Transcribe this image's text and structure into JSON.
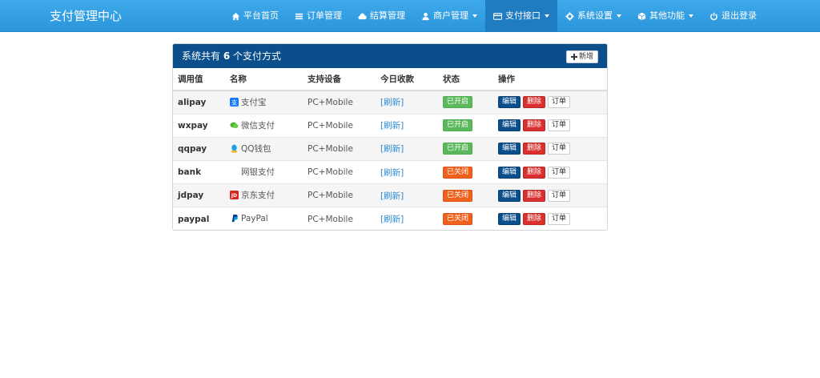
{
  "navbar": {
    "brand": "支付管理中心",
    "items": [
      {
        "label": "平台首页",
        "icon": "home-icon"
      },
      {
        "label": "订单管理",
        "icon": "list-icon"
      },
      {
        "label": "结算管理",
        "icon": "cloud-icon"
      },
      {
        "label": "商户管理",
        "icon": "user-icon",
        "dropdown": true
      },
      {
        "label": "支付接口",
        "icon": "credit-card-icon",
        "dropdown": true,
        "active": true
      },
      {
        "label": "系统设置",
        "icon": "gear-icon",
        "dropdown": true
      },
      {
        "label": "其他功能",
        "icon": "cube-icon",
        "dropdown": true
      },
      {
        "label": "退出登录",
        "icon": "power-icon"
      }
    ]
  },
  "panel": {
    "title_prefix": "系统共有",
    "count": "6",
    "title_suffix": "个支付方式",
    "add_label": "新增"
  },
  "table": {
    "headers": [
      "调用值",
      "名称",
      "支持设备",
      "今日收款",
      "状态",
      "操作"
    ],
    "rows": [
      {
        "code": "alipay",
        "name": "支付宝",
        "icon": "alipay-icon",
        "device": "PC+Mobile",
        "income": "[刷新]",
        "status": "已开启",
        "enabled": true
      },
      {
        "code": "wxpay",
        "name": "微信支付",
        "icon": "wechat-icon",
        "device": "PC+Mobile",
        "income": "[刷新]",
        "status": "已开启",
        "enabled": true
      },
      {
        "code": "qqpay",
        "name": "QQ钱包",
        "icon": "qq-icon",
        "device": "PC+Mobile",
        "income": "[刷新]",
        "status": "已开启",
        "enabled": true
      },
      {
        "code": "bank",
        "name": "网银支付",
        "icon": "",
        "device": "PC+Mobile",
        "income": "[刷新]",
        "status": "已关闭",
        "enabled": false
      },
      {
        "code": "jdpay",
        "name": "京东支付",
        "icon": "jd-icon",
        "device": "PC+Mobile",
        "income": "[刷新]",
        "status": "已关闭",
        "enabled": false
      },
      {
        "code": "paypal",
        "name": "PayPal",
        "icon": "paypal-icon",
        "device": "PC+Mobile",
        "income": "[刷新]",
        "status": "已关闭",
        "enabled": false
      }
    ],
    "actions": {
      "edit": "编辑",
      "delete": "删除",
      "order": "订单"
    }
  },
  "colors": {
    "navbar": "#2b95dc",
    "panel_heading": "#0a4f8c",
    "enabled": "#5cb85c",
    "disabled": "#f0621c",
    "delete": "#d9302f"
  }
}
